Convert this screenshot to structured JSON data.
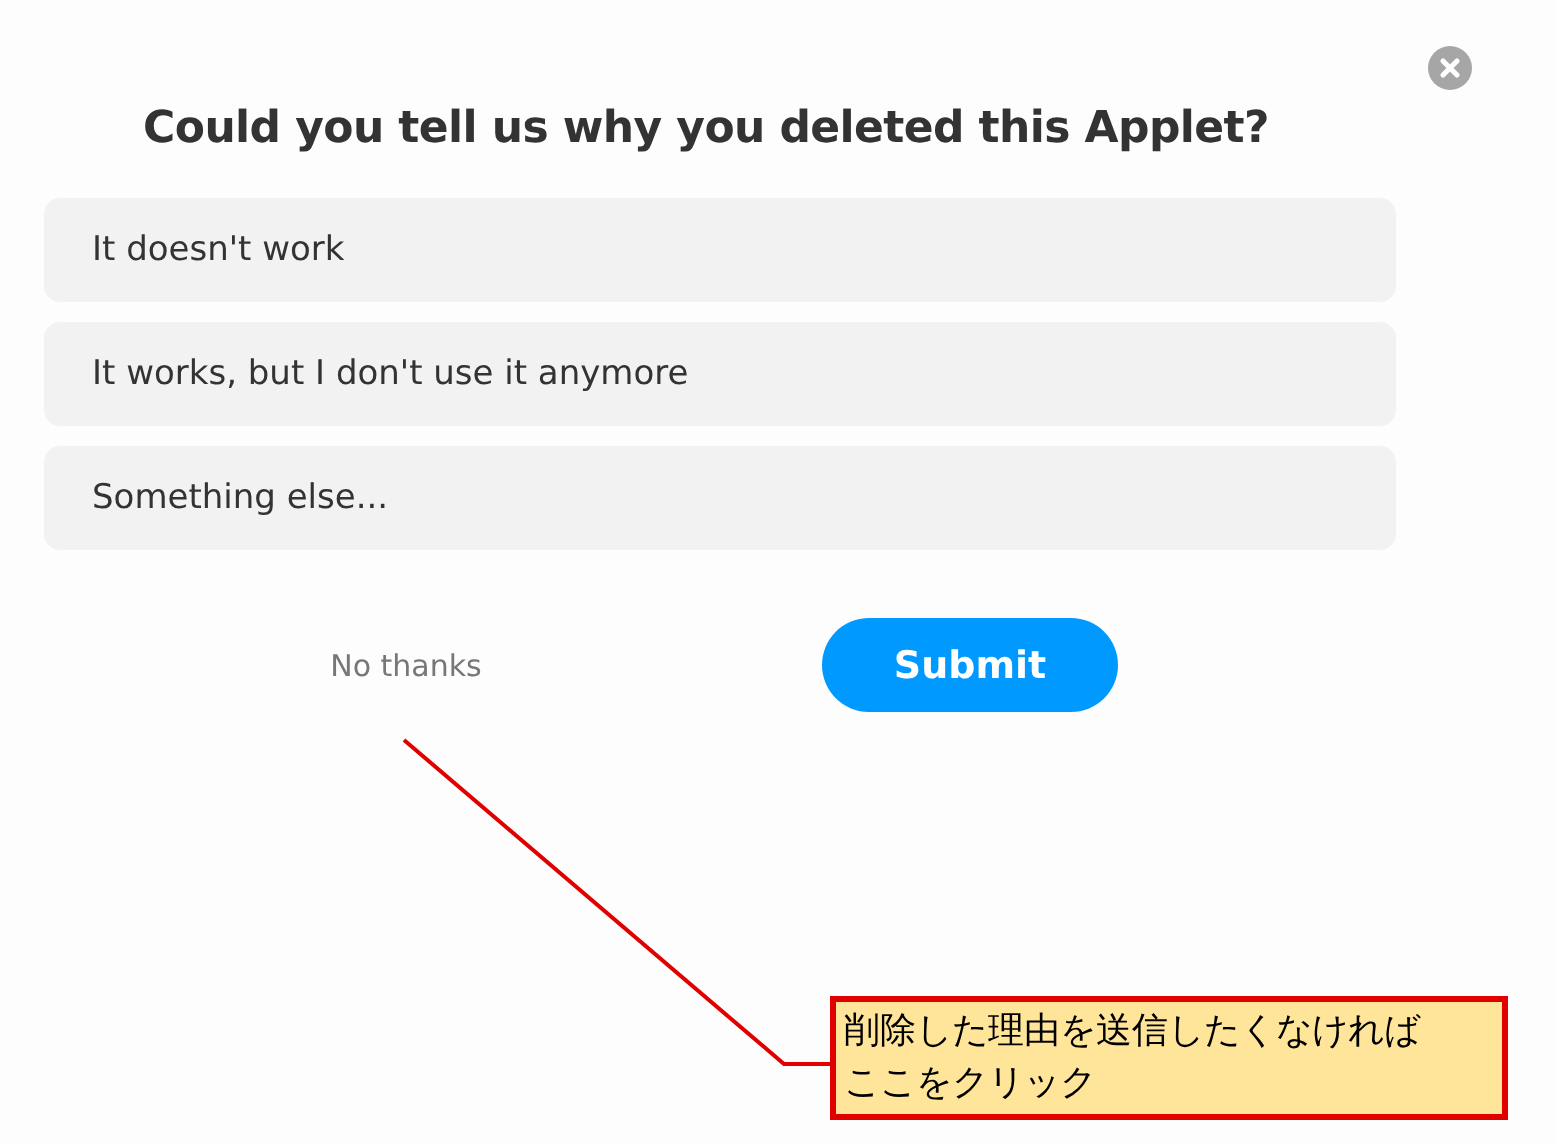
{
  "dialog": {
    "title": "Could you tell us why you deleted this Applet?",
    "options": [
      {
        "label": "It doesn't work"
      },
      {
        "label": "It works, but I don't use it anymore"
      },
      {
        "label": "Something else..."
      }
    ],
    "dismiss_link": "No thanks",
    "submit_button": "Submit"
  },
  "annotation": {
    "lines": [
      "削除した理由を送信したくなければ",
      "ここをクリック"
    ]
  }
}
